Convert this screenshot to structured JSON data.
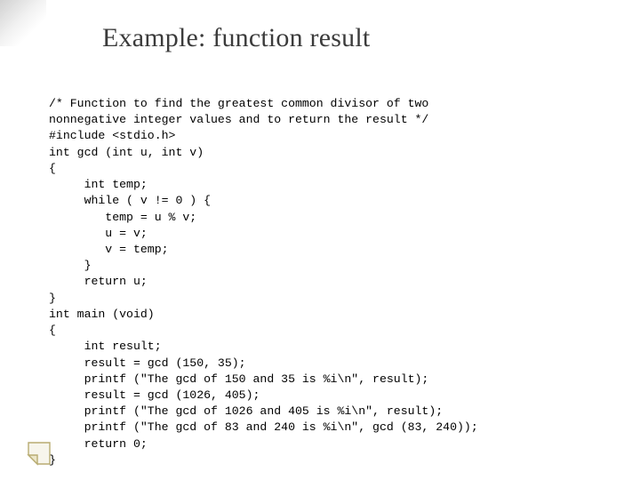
{
  "slide": {
    "title": "Example: function result",
    "code_lines": {
      "l0": "/* Function to find the greatest common divisor of two",
      "l1": "nonnegative integer values and to return the result */",
      "l2": "#include <stdio.h>",
      "l3": "int gcd (int u, int v)",
      "l4": "{",
      "l5": "     int temp;",
      "l6": "     while ( v != 0 ) {",
      "l7": "        temp = u % v;",
      "l8": "        u = v;",
      "l9": "        v = temp;",
      "l10": "     }",
      "l11": "     return u;",
      "l12": "}",
      "l13": "int main (void)",
      "l14": "{",
      "l15": "     int result;",
      "l16": "     result = gcd (150, 35);",
      "l17": "     printf (\"The gcd of 150 and 35 is %i\\n\", result);",
      "l18": "     result = gcd (1026, 405);",
      "l19": "     printf (\"The gcd of 1026 and 405 is %i\\n\", result);",
      "l20": "     printf (\"The gcd of 83 and 240 is %i\\n\", gcd (83, 240));",
      "l21": "     return 0;",
      "l22": "}"
    }
  },
  "icons": {
    "corner_shadow": "corner-shadow",
    "page_fold": "page-fold-icon"
  }
}
